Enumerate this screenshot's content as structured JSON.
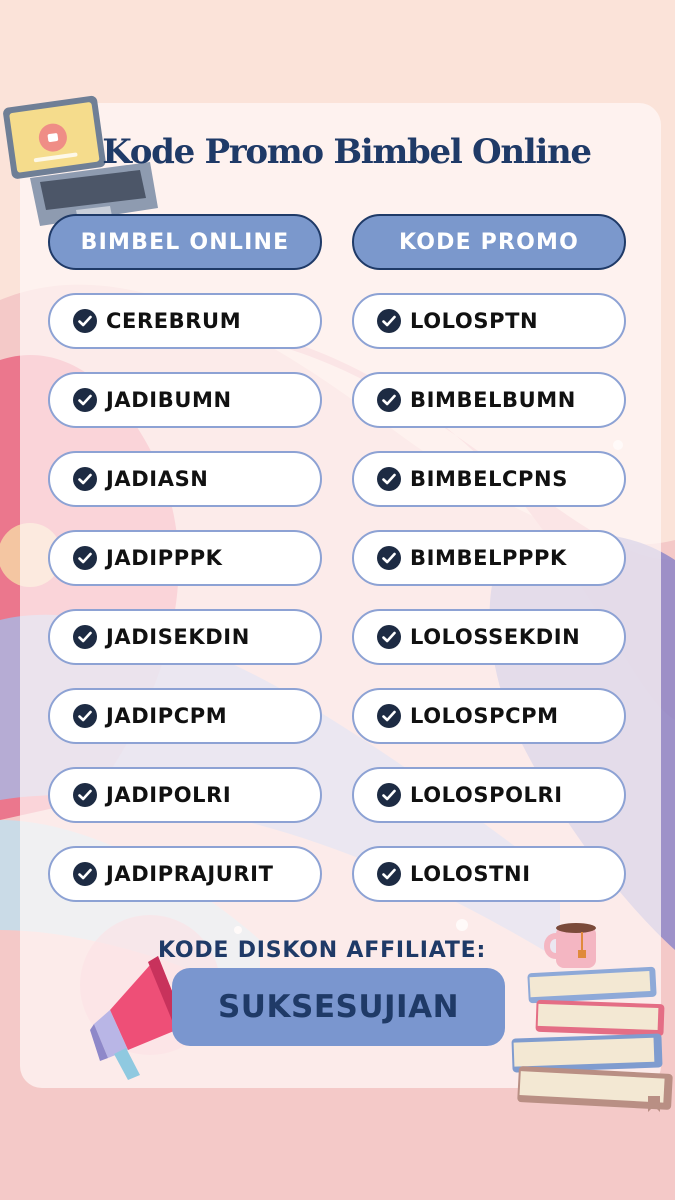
{
  "title": "Kode Promo Bimbel Online",
  "columns": {
    "left_header": "BIMBEL ONLINE",
    "right_header": "KODE PROMO"
  },
  "rows": [
    {
      "bimbel": "CEREBRUM",
      "kode": "LOLOSPTN"
    },
    {
      "bimbel": "JADIBUMN",
      "kode": "BIMBELBUMN"
    },
    {
      "bimbel": "JADIASN",
      "kode": "BIMBELCPNS"
    },
    {
      "bimbel": "JADIPPPK",
      "kode": "BIMBELPPPK"
    },
    {
      "bimbel": "JADISEKDIN",
      "kode": "LOLOSSEKDIN"
    },
    {
      "bimbel": "JADIPCPM",
      "kode": "LOLOSPCPM"
    },
    {
      "bimbel": "JADIPOLRI",
      "kode": "LOLOSPOLRI"
    },
    {
      "bimbel": "JADIPRAJURIT",
      "kode": "LOLOSTNI"
    }
  ],
  "affiliate": {
    "label": "KODE DISKON AFFILIATE:",
    "code": "SUKSESUJIAN"
  },
  "icons": {
    "check": "check-circle-icon",
    "laptop": "laptop-icon",
    "megaphone": "megaphone-icon",
    "books": "books-icon",
    "mug": "mug-icon"
  },
  "colors": {
    "accent": "#7b98cc",
    "navy": "#1f3a67",
    "background": "#fbe3d9"
  }
}
